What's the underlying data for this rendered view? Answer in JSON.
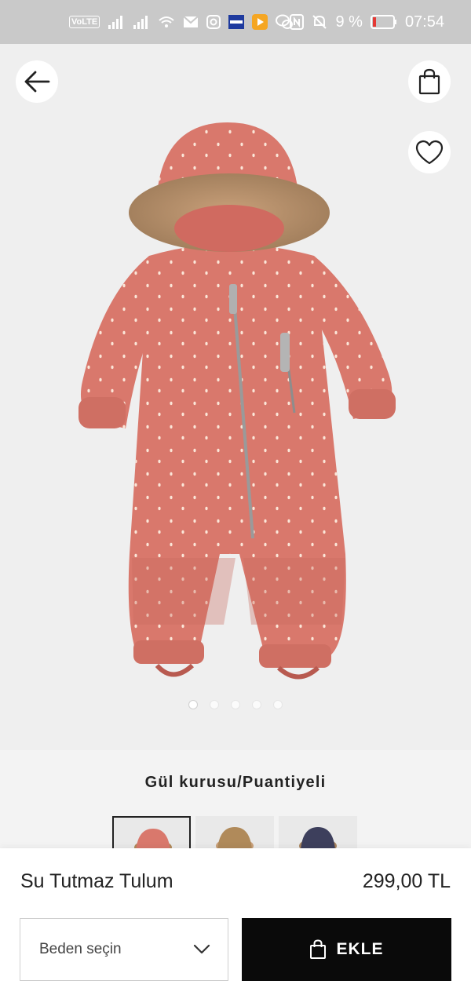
{
  "status_bar": {
    "volte": "VoLTE",
    "battery_percent": "9 %",
    "time": "07:54"
  },
  "product": {
    "name": "Su Tutmaz Tulum",
    "price": "299,00 TL",
    "color_name": "Gül kurusu/Puantiyeli",
    "image_count": 5,
    "active_image_index": 0,
    "main_color": "#d9786c",
    "swatches": [
      {
        "name": "swatch-rose",
        "color": "#d9786c"
      },
      {
        "name": "swatch-leopard",
        "color": "#b08a5a"
      },
      {
        "name": "swatch-navy",
        "color": "#3d3f5c"
      }
    ]
  },
  "actions": {
    "size_placeholder": "Beden seçin",
    "add_label": "EKLE"
  },
  "icons": {
    "back": "arrow-left-icon",
    "bag": "shopping-bag-icon",
    "favorite": "heart-icon",
    "dropdown": "chevron-down-icon"
  }
}
